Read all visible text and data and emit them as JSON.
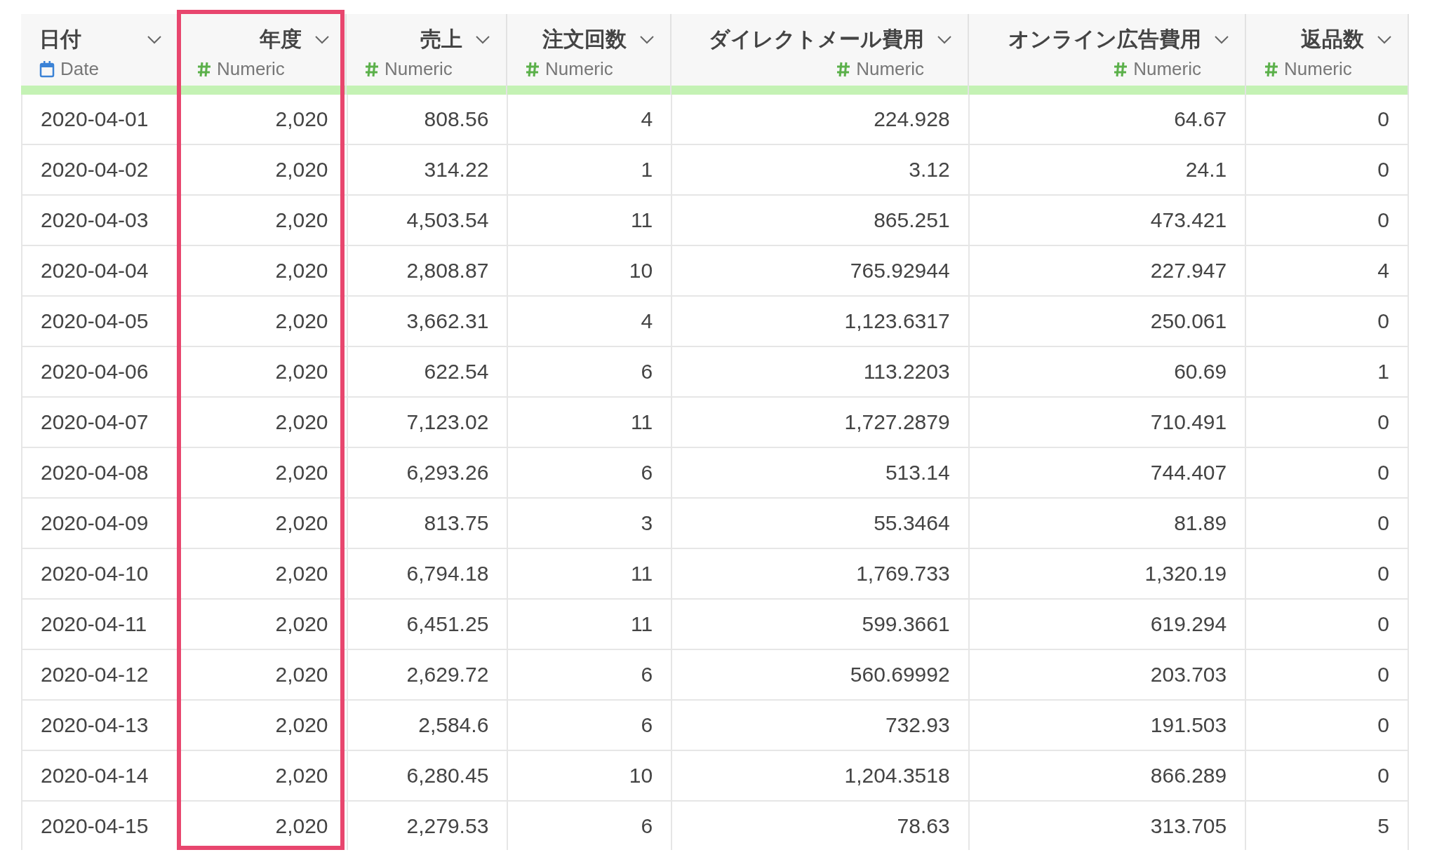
{
  "table": {
    "columns": [
      {
        "name": "日付",
        "type": "Date",
        "kind": "date",
        "selected": false
      },
      {
        "name": "年度",
        "type": "Numeric",
        "kind": "numeric",
        "selected": true
      },
      {
        "name": "売上",
        "type": "Numeric",
        "kind": "numeric",
        "selected": false
      },
      {
        "name": "注文回数",
        "type": "Numeric",
        "kind": "numeric",
        "selected": false
      },
      {
        "name": "ダイレクトメール費用",
        "type": "Numeric",
        "kind": "numeric",
        "selected": false
      },
      {
        "name": "オンライン広告費用",
        "type": "Numeric",
        "kind": "numeric",
        "selected": false
      },
      {
        "name": "返品数",
        "type": "Numeric",
        "kind": "numeric",
        "selected": false
      }
    ],
    "rows": [
      [
        "2020-04-01",
        "2,020",
        "808.56",
        "4",
        "224.928",
        "64.67",
        "0"
      ],
      [
        "2020-04-02",
        "2,020",
        "314.22",
        "1",
        "3.12",
        "24.1",
        "0"
      ],
      [
        "2020-04-03",
        "2,020",
        "4,503.54",
        "11",
        "865.251",
        "473.421",
        "0"
      ],
      [
        "2020-04-04",
        "2,020",
        "2,808.87",
        "10",
        "765.92944",
        "227.947",
        "4"
      ],
      [
        "2020-04-05",
        "2,020",
        "3,662.31",
        "4",
        "1,123.6317",
        "250.061",
        "0"
      ],
      [
        "2020-04-06",
        "2,020",
        "622.54",
        "6",
        "113.2203",
        "60.69",
        "1"
      ],
      [
        "2020-04-07",
        "2,020",
        "7,123.02",
        "11",
        "1,727.2879",
        "710.491",
        "0"
      ],
      [
        "2020-04-08",
        "2,020",
        "6,293.26",
        "6",
        "513.14",
        "744.407",
        "0"
      ],
      [
        "2020-04-09",
        "2,020",
        "813.75",
        "3",
        "55.3464",
        "81.89",
        "0"
      ],
      [
        "2020-04-10",
        "2,020",
        "6,794.18",
        "11",
        "1,769.733",
        "1,320.19",
        "0"
      ],
      [
        "2020-04-11",
        "2,020",
        "6,451.25",
        "11",
        "599.3661",
        "619.294",
        "0"
      ],
      [
        "2020-04-12",
        "2,020",
        "2,629.72",
        "6",
        "560.69992",
        "203.703",
        "0"
      ],
      [
        "2020-04-13",
        "2,020",
        "2,584.6",
        "6",
        "732.93",
        "191.503",
        "0"
      ],
      [
        "2020-04-14",
        "2,020",
        "6,280.45",
        "10",
        "1,204.3518",
        "866.289",
        "0"
      ],
      [
        "2020-04-15",
        "2,020",
        "2,279.53",
        "6",
        "78.63",
        "313.705",
        "5"
      ]
    ]
  }
}
